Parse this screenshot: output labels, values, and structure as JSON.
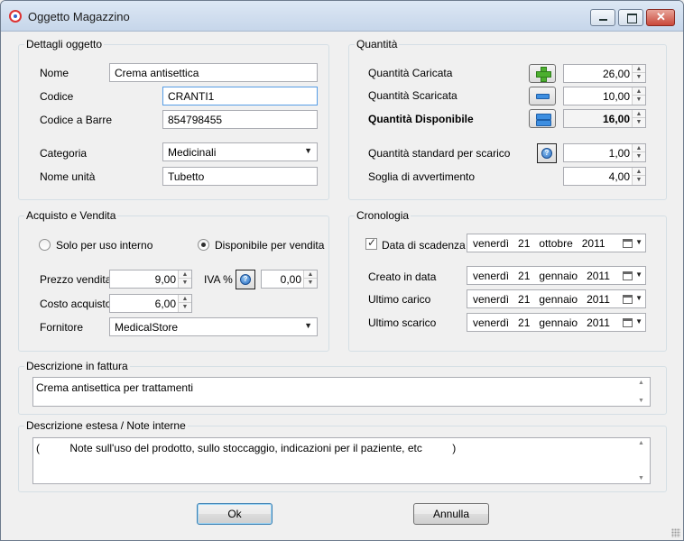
{
  "window": {
    "title": "Oggetto Magazzino"
  },
  "dettagli": {
    "legend": "Dettagli oggetto",
    "nome_label": "Nome",
    "nome_value": "Crema antisettica",
    "codice_label": "Codice",
    "codice_value": "CRANTI1",
    "barre_label": "Codice a Barre",
    "barre_value": "854798455",
    "categoria_label": "Categoria",
    "categoria_value": "Medicinali",
    "unita_label": "Nome unità",
    "unita_value": "Tubetto"
  },
  "quantita": {
    "legend": "Quantità",
    "caricata_label": "Quantità Caricata",
    "caricata_value": "26,00",
    "scaricata_label": "Quantità Scaricata",
    "scaricata_value": "10,00",
    "disponibile_label": "Quantità Disponibile",
    "disponibile_value": "16,00",
    "standard_label": "Quantità standard per scarico",
    "standard_value": "1,00",
    "soglia_label": "Soglia di avvertimento",
    "soglia_value": "4,00"
  },
  "acquisto": {
    "legend": "Acquisto e Vendita",
    "radio_interno": "Solo per uso interno",
    "radio_vendita": "Disponibile per vendita",
    "prezzo_label": "Prezzo vendita",
    "prezzo_value": "9,00",
    "iva_label": "IVA %",
    "iva_value": "0,00",
    "costo_label": "Costo acquisto",
    "costo_value": "6,00",
    "fornitore_label": "Fornitore",
    "fornitore_value": "MedicalStore"
  },
  "cronologia": {
    "legend": "Cronologia",
    "scadenza_label": "Data di scadenza",
    "scadenza_value": "venerdì   21   ottobre   2011",
    "creato_label": "Creato in data",
    "creato_value": "venerdì   21   gennaio   2011",
    "carico_label": "Ultimo carico",
    "carico_value": "venerdì   21   gennaio   2011",
    "scarico_label": "Ultimo scarico",
    "scarico_value": "venerdì   21   gennaio   2011"
  },
  "fattura": {
    "legend": "Descrizione in fattura",
    "value": "Crema antisettica per trattamenti"
  },
  "note": {
    "legend": "Descrizione estesa / Note interne",
    "value": "(          Note sull'uso del prodotto, sullo stoccaggio, indicazioni per il paziente, etc          )"
  },
  "buttons": {
    "ok": "Ok",
    "annulla": "Annulla"
  }
}
